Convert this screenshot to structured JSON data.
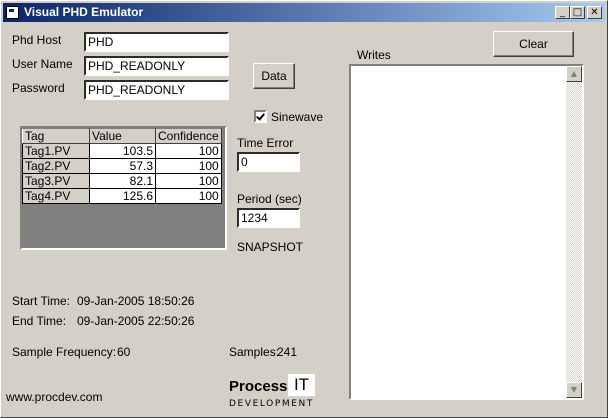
{
  "window": {
    "title": "Visual PHD Emulator",
    "controls": {
      "minimize": "_",
      "maximize": "□",
      "close": "✕"
    }
  },
  "connection": {
    "host_label": "Phd Host",
    "host_value": "PHD",
    "user_label": "User Name",
    "user_value": "PHD_READONLY",
    "password_label": "Password",
    "password_value": "PHD_READONLY"
  },
  "buttons": {
    "data": "Data",
    "clear": "Clear"
  },
  "sinewave": {
    "label": "Sinewave",
    "checked": true
  },
  "grid": {
    "headers": [
      "Tag",
      "Value",
      "Confidence"
    ],
    "rows": [
      {
        "tag": "Tag1.PV",
        "value": "103.5",
        "confidence": "100"
      },
      {
        "tag": "Tag2.PV",
        "value": "57.3",
        "confidence": "100"
      },
      {
        "tag": "Tag3.PV",
        "value": "82.1",
        "confidence": "100"
      },
      {
        "tag": "Tag4.PV",
        "value": "125.6",
        "confidence": "100"
      }
    ]
  },
  "time_error": {
    "label": "Time Error",
    "value": "0"
  },
  "period": {
    "label": "Period (sec)",
    "value": "1234"
  },
  "mode": "SNAPSHOT",
  "writes": {
    "label": "Writes"
  },
  "times": {
    "start_label": "Start Time:",
    "start_value": "09-Jan-2005 18:50:26",
    "end_label": "End Time:",
    "end_value": "09-Jan-2005 22:50:26"
  },
  "stats": {
    "frequency_label": "Sample Frequency:",
    "frequency_value": "60",
    "samples_label": "Samples:",
    "samples_value": "241"
  },
  "footer": {
    "website": "www.procdev.com",
    "logo_process": "Process",
    "logo_it": "IT",
    "logo_dev": "DEVELOPMENT"
  },
  "colors": {
    "titlebar_start": "#0a246a",
    "titlebar_end": "#a6caf0",
    "face": "#d4d0c8"
  }
}
